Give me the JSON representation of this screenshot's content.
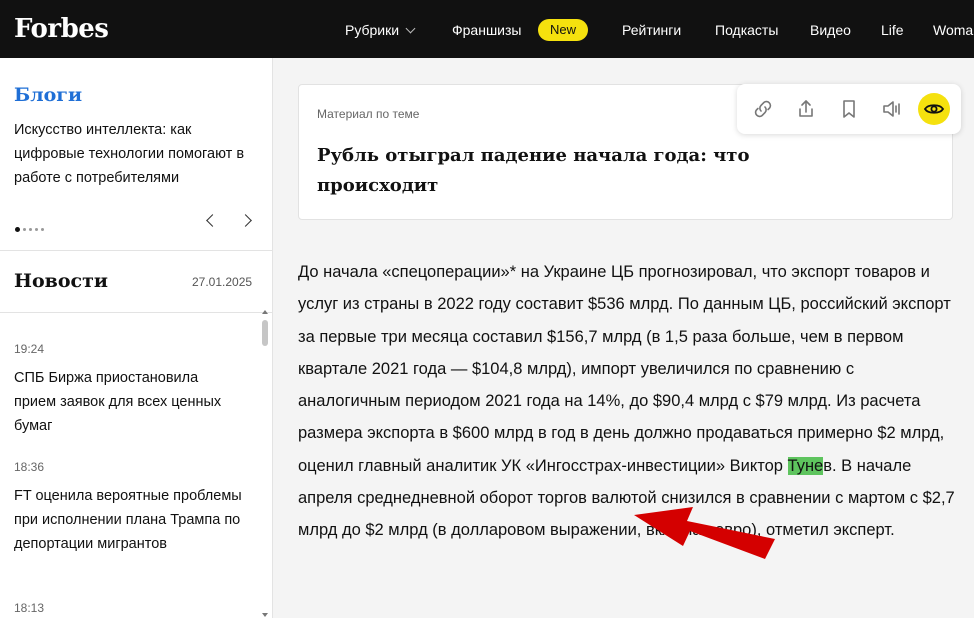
{
  "header": {
    "logo": "Forbes",
    "nav": [
      "Рубрики",
      "Франшизы",
      "Рейтинги",
      "Подкасты",
      "Видео",
      "Life",
      "Woma"
    ],
    "new_badge": "New"
  },
  "sidebar": {
    "blogs_title": "Блоги",
    "blogs_text": "Искусство интеллекта: как цифровые технологии помогают в работе с потребителями",
    "news_title": "Новости",
    "news_date": "27.01.2025",
    "news": [
      {
        "time": "19:24",
        "text": "СПБ Биржа приостановила прием заявок для всех ценных бумаг"
      },
      {
        "time": "18:36",
        "text": "FT оценила вероятные проблемы при исполнении плана Трампа по депортации мигрантов"
      },
      {
        "time": "18:13",
        "text": ""
      }
    ]
  },
  "related": {
    "label": "Материал по теме",
    "title": "Рубль отыграл падение начала года: что происходит"
  },
  "toolbar": {
    "icons": [
      "link-icon",
      "share-icon",
      "bookmark-icon",
      "audio-icon",
      "eye-icon"
    ]
  },
  "article": {
    "before": "До начала «спецоперации»* на Украине ЦБ прогнозировал, что экспорт товаров и услуг из страны в 2022 году составит $536 млрд. По данным ЦБ, российский экспорт за первые три месяца составил $156,7 млрд (в 1,5 раза больше, чем в первом квартале 2021 года — $104,8 млрд), импорт увеличился по сравнению с аналогичным периодом 2021 года на 14%, до $90,4 млрд с $79 млрд. Из расчета размера экспорта в $600 млрд в год в день должно продаваться примерно $2 млрд, оценил главный аналитик УК «Ингосстрах-инвестиции» Виктор ",
    "highlight": "Туне",
    "after": "в. В начале апреля среднедневной оборот торгов валютой снизился в сравнении с мартом с $2,7 млрд до $2 млрд (в долларовом выражении, включая евро), отметил эксперт."
  },
  "colors": {
    "header_bg": "#111111",
    "accent_yellow": "#f5e10e",
    "blog_blue": "#1f6fd6",
    "highlight_green": "#5ec45e",
    "arrow_red": "#d40000"
  }
}
